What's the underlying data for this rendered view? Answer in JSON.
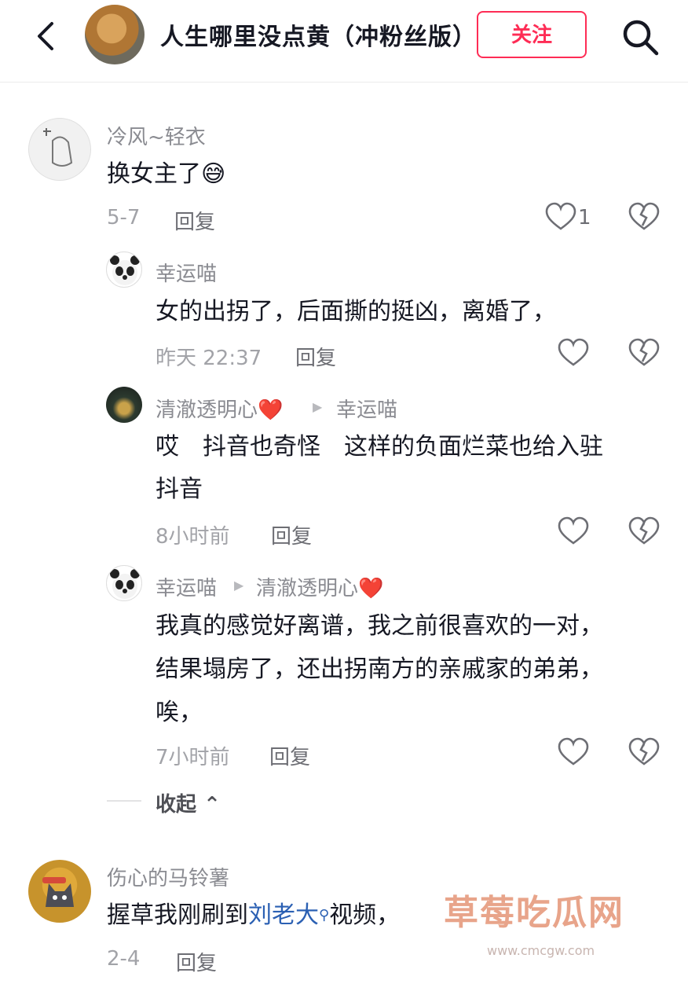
{
  "header": {
    "channel_title": "人生哪里没点黄（冲粉丝版）",
    "follow_label": "关注"
  },
  "comments": [
    {
      "username": "冷风~轻衣",
      "text": "换女主了😅",
      "date": "5-7",
      "reply_label": "回复",
      "like_count": "1"
    }
  ],
  "replies": [
    {
      "username": "幸运喵",
      "text": "女的出拐了，后面撕的挺凶，离婚了，",
      "time": "昨天 22:37",
      "reply_label": "回复"
    },
    {
      "username": "清澈透明心❤️",
      "reply_to": "幸运喵",
      "text_line1": "哎　抖音也奇怪　这样的负面烂菜也给入驻",
      "text_line2": "抖音",
      "time": "8小时前",
      "reply_label": "回复"
    },
    {
      "username": "幸运喵",
      "reply_to": "清澈透明心❤️",
      "text_line1": "我真的感觉好离谱，我之前很喜欢的一对，",
      "text_line2": "结果塌房了，还出拐南方的亲戚家的弟弟，",
      "text_line3": "唉，",
      "time": "7小时前",
      "reply_label": "回复"
    }
  ],
  "collapse_label": "收起",
  "bottom_comment": {
    "username": "伤心的马铃薯",
    "text_before": "握草我刚刷到",
    "link_text": "刘老大",
    "text_after": "视频，",
    "date": "2-4",
    "reply_label": "回复"
  },
  "watermark": {
    "title": "草莓吃瓜网",
    "url": "www.cmcgw.com"
  },
  "colors": {
    "accent": "#fe2c55",
    "link": "#2b60b3",
    "muted": "#8a8b91"
  }
}
